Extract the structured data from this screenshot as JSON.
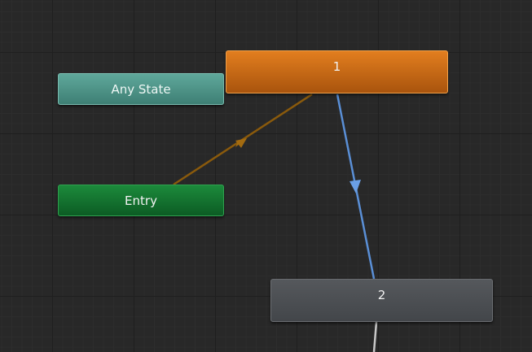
{
  "nodes": {
    "any_state": {
      "label": "Any State"
    },
    "entry": {
      "label": "Entry"
    },
    "state_1": {
      "label": "1"
    },
    "state_2": {
      "label": "2"
    }
  },
  "colors": {
    "any_state": "#4f968a",
    "entry": "#137533",
    "state_1": "#c86a16",
    "state_2": "#4b4e52",
    "entry_transition": "#8a5a0c",
    "state_transition": "#5a8fd6",
    "outgoing_transition": "#c8c8c8"
  }
}
